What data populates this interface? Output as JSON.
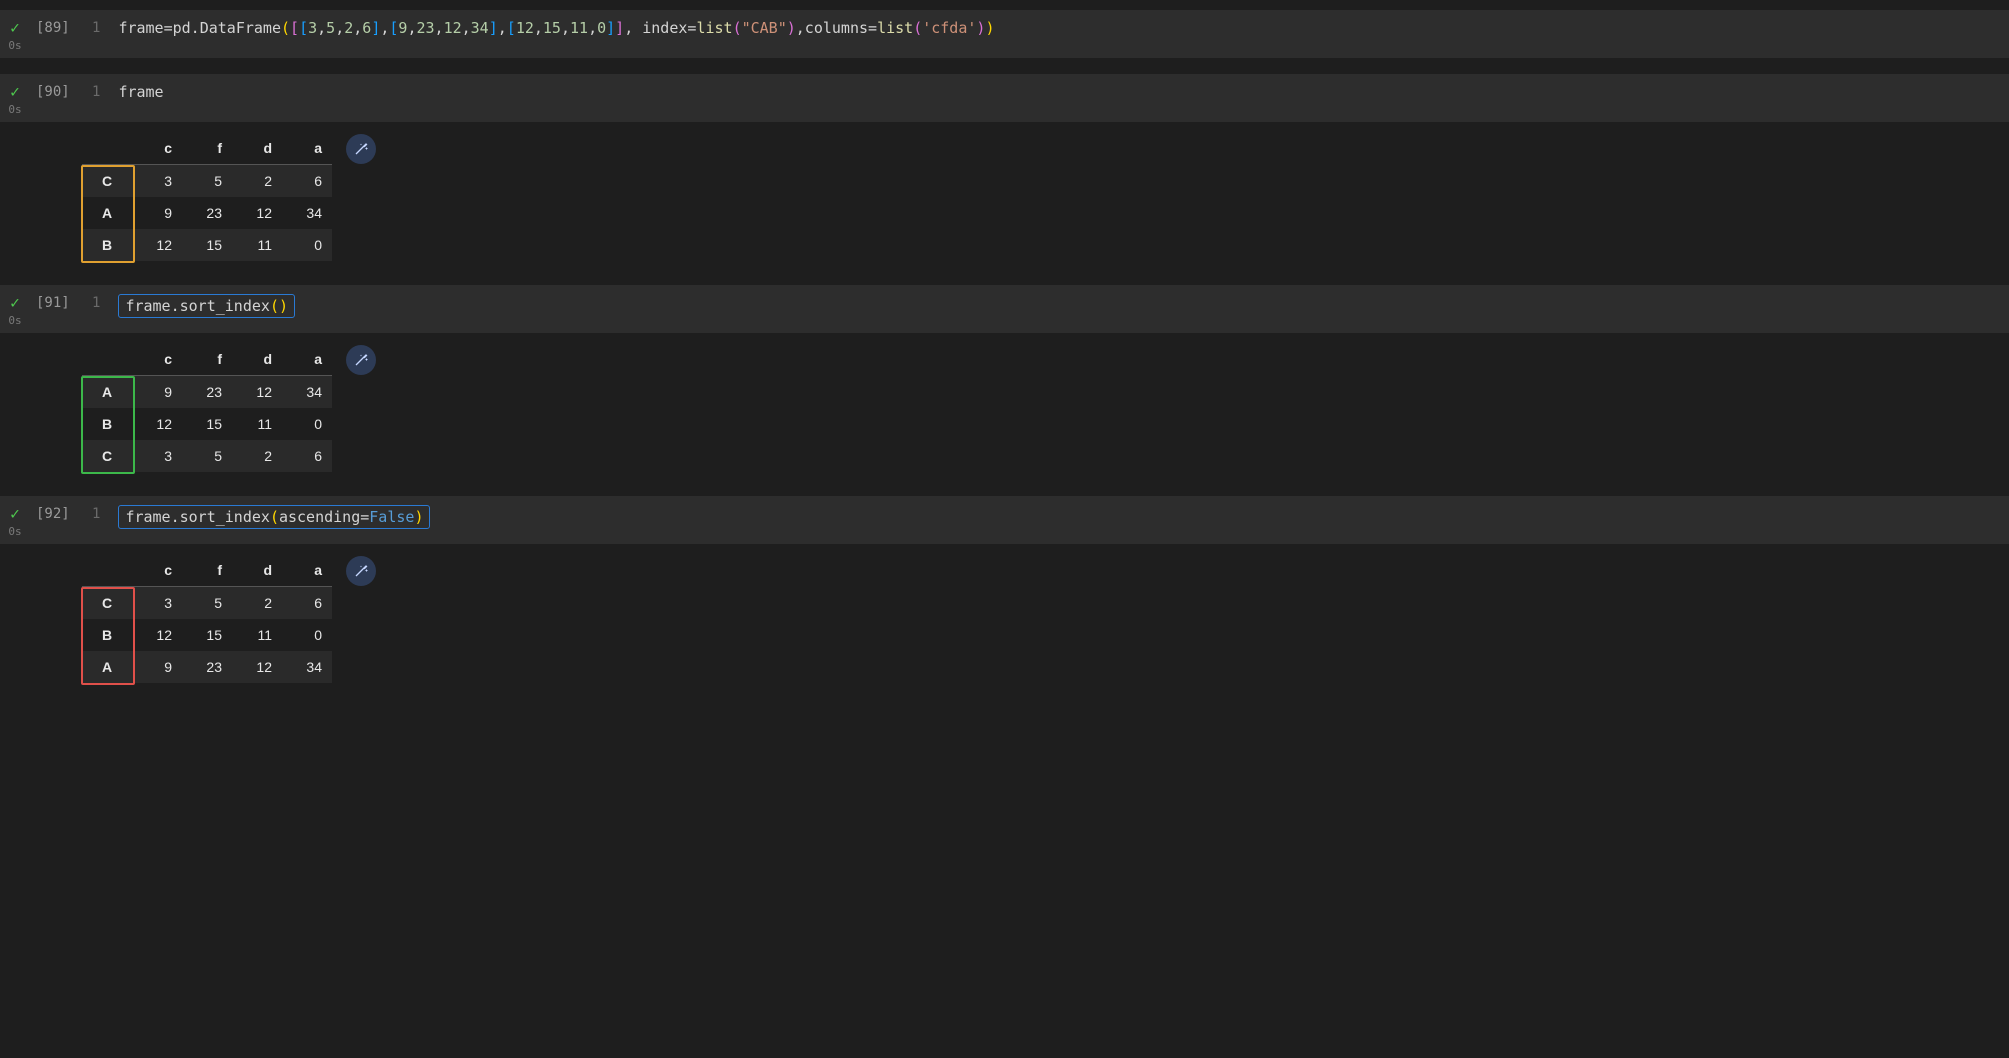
{
  "cells": [
    {
      "label": "[89]",
      "time": "0s",
      "line_number": "1",
      "code_tokens": [
        {
          "t": "frame",
          "c": "tok-default"
        },
        {
          "t": "=",
          "c": "tok-default"
        },
        {
          "t": "pd.DataFrame",
          "c": "tok-default"
        },
        {
          "t": "(",
          "c": "tok-paren"
        },
        {
          "t": "[",
          "c": "tok-paren2"
        },
        {
          "t": "[",
          "c": "tok-paren3"
        },
        {
          "t": "3",
          "c": "tok-number"
        },
        {
          "t": ",",
          "c": "tok-default"
        },
        {
          "t": "5",
          "c": "tok-number"
        },
        {
          "t": ",",
          "c": "tok-default"
        },
        {
          "t": "2",
          "c": "tok-number"
        },
        {
          "t": ",",
          "c": "tok-default"
        },
        {
          "t": "6",
          "c": "tok-number"
        },
        {
          "t": "]",
          "c": "tok-paren3"
        },
        {
          "t": ",",
          "c": "tok-default"
        },
        {
          "t": "[",
          "c": "tok-paren3"
        },
        {
          "t": "9",
          "c": "tok-number"
        },
        {
          "t": ",",
          "c": "tok-default"
        },
        {
          "t": "23",
          "c": "tok-number"
        },
        {
          "t": ",",
          "c": "tok-default"
        },
        {
          "t": "12",
          "c": "tok-number"
        },
        {
          "t": ",",
          "c": "tok-default"
        },
        {
          "t": "34",
          "c": "tok-number"
        },
        {
          "t": "]",
          "c": "tok-paren3"
        },
        {
          "t": ",",
          "c": "tok-default"
        },
        {
          "t": "[",
          "c": "tok-paren3"
        },
        {
          "t": "12",
          "c": "tok-number"
        },
        {
          "t": ",",
          "c": "tok-default"
        },
        {
          "t": "15",
          "c": "tok-number"
        },
        {
          "t": ",",
          "c": "tok-default"
        },
        {
          "t": "11",
          "c": "tok-number"
        },
        {
          "t": ",",
          "c": "tok-default"
        },
        {
          "t": "0",
          "c": "tok-number"
        },
        {
          "t": "]",
          "c": "tok-paren3"
        },
        {
          "t": "]",
          "c": "tok-paren2"
        },
        {
          "t": ", index",
          "c": "tok-default"
        },
        {
          "t": "=",
          "c": "tok-default"
        },
        {
          "t": "list",
          "c": "tok-func"
        },
        {
          "t": "(",
          "c": "tok-paren2"
        },
        {
          "t": "\"CAB\"",
          "c": "tok-string"
        },
        {
          "t": ")",
          "c": "tok-paren2"
        },
        {
          "t": ",columns",
          "c": "tok-default"
        },
        {
          "t": "=",
          "c": "tok-default"
        },
        {
          "t": "list",
          "c": "tok-func"
        },
        {
          "t": "(",
          "c": "tok-paren2"
        },
        {
          "t": "'cfda'",
          "c": "tok-string"
        },
        {
          "t": ")",
          "c": "tok-paren2"
        },
        {
          "t": ")",
          "c": "tok-paren"
        }
      ],
      "boxed": false,
      "output": null
    },
    {
      "label": "[90]",
      "time": "0s",
      "line_number": "1",
      "code_tokens": [
        {
          "t": "frame",
          "c": "tok-default"
        }
      ],
      "boxed": false,
      "output": {
        "columns": [
          "c",
          "f",
          "d",
          "a"
        ],
        "rows": [
          {
            "idx": "C",
            "vals": [
              "3",
              "5",
              "2",
              "6"
            ]
          },
          {
            "idx": "A",
            "vals": [
              "9",
              "23",
              "12",
              "34"
            ]
          },
          {
            "idx": "B",
            "vals": [
              "12",
              "15",
              "11",
              "0"
            ]
          }
        ],
        "highlight_color": "#e0a030"
      }
    },
    {
      "label": "[91]",
      "time": "0s",
      "line_number": "1",
      "code_tokens": [
        {
          "t": "frame.sort_index",
          "c": "tok-default"
        },
        {
          "t": "(",
          "c": "tok-paren"
        },
        {
          "t": ")",
          "c": "tok-paren"
        }
      ],
      "boxed": true,
      "output": {
        "columns": [
          "c",
          "f",
          "d",
          "a"
        ],
        "rows": [
          {
            "idx": "A",
            "vals": [
              "9",
              "23",
              "12",
              "34"
            ]
          },
          {
            "idx": "B",
            "vals": [
              "12",
              "15",
              "11",
              "0"
            ]
          },
          {
            "idx": "C",
            "vals": [
              "3",
              "5",
              "2",
              "6"
            ]
          }
        ],
        "highlight_color": "#3cb84a"
      }
    },
    {
      "label": "[92]",
      "time": "0s",
      "line_number": "1",
      "code_tokens": [
        {
          "t": "frame.sort_index",
          "c": "tok-default"
        },
        {
          "t": "(",
          "c": "tok-paren"
        },
        {
          "t": "ascending",
          "c": "tok-default"
        },
        {
          "t": "=",
          "c": "tok-default"
        },
        {
          "t": "False",
          "c": "tok-kw"
        },
        {
          "t": ")",
          "c": "tok-paren"
        }
      ],
      "boxed": true,
      "output": {
        "columns": [
          "c",
          "f",
          "d",
          "a"
        ],
        "rows": [
          {
            "idx": "C",
            "vals": [
              "3",
              "5",
              "2",
              "6"
            ]
          },
          {
            "idx": "B",
            "vals": [
              "12",
              "15",
              "11",
              "0"
            ]
          },
          {
            "idx": "A",
            "vals": [
              "9",
              "23",
              "12",
              "34"
            ]
          }
        ],
        "highlight_color": "#e0504a"
      }
    }
  ],
  "icons": {
    "magic_wand": "✨",
    "check": "✓"
  }
}
